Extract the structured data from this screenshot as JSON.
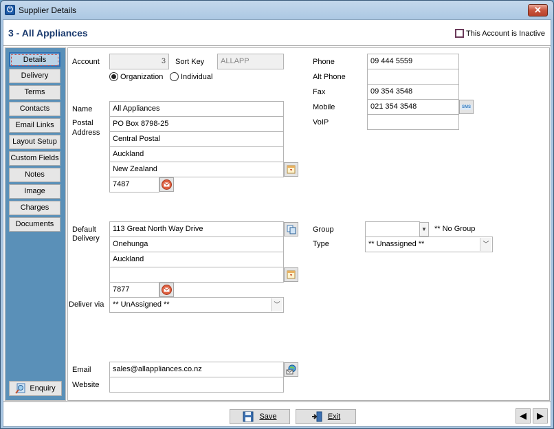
{
  "window": {
    "title": "Supplier Details",
    "close_icon": "close-icon",
    "app_icon": "power-icon"
  },
  "header": {
    "account_title": "3 - All Appliances",
    "inactive_label": "This Account is Inactive",
    "inactive_checked": false
  },
  "sidebar": {
    "items": [
      {
        "label": "Details",
        "active": true
      },
      {
        "label": "Delivery"
      },
      {
        "label": "Terms"
      },
      {
        "label": "Contacts"
      },
      {
        "label": "Email Links"
      },
      {
        "label": "Layout Setup"
      },
      {
        "label": "Custom Fields"
      },
      {
        "label": "Notes"
      },
      {
        "label": "Image"
      },
      {
        "label": "Charges"
      },
      {
        "label": "Documents"
      }
    ],
    "enquiry_label": "Enquiry"
  },
  "form": {
    "account_label": "Account",
    "account_value": "3",
    "sort_key_label": "Sort Key",
    "sort_key_value": "ALLAPP",
    "radio_organization": "Organization",
    "radio_individual": "Individual",
    "selected_type": "Organization",
    "name_label": "Name",
    "name_value": "All Appliances",
    "postal_label_1": "Postal",
    "postal_label_2": "Address",
    "postal_lines": [
      "PO Box 8798-25",
      "Central Postal",
      "Auckland",
      "New Zealand"
    ],
    "postal_code": "7487",
    "delivery_label_1": "Default",
    "delivery_label_2": "Delivery",
    "delivery_lines": [
      "113 Great North Way Drive",
      "Onehunga",
      "Auckland",
      ""
    ],
    "delivery_code": "7877",
    "deliver_via_label": "Deliver via",
    "deliver_via_value": "** UnAssigned **",
    "email_label": "Email",
    "email_value": "sales@allappliances.co.nz",
    "website_label": "Website",
    "website_value": "",
    "phone_label": "Phone",
    "phone_value": "09 444 5559",
    "alt_phone_label": "Alt Phone",
    "alt_phone_value": "",
    "fax_label": "Fax",
    "fax_value": "09 354 3548",
    "mobile_label": "Mobile",
    "mobile_value": "021 354 3548",
    "sms_icon_text": "SMS",
    "voip_label": "VoIP",
    "voip_value": "",
    "group_label": "Group",
    "group_value": "",
    "group_desc": "** No Group",
    "type_label": "Type",
    "type_value": "** Unassigned **"
  },
  "footer": {
    "save_label": "Save",
    "exit_label": "Exit",
    "prev_icon": "◀",
    "next_icon": "▶"
  }
}
